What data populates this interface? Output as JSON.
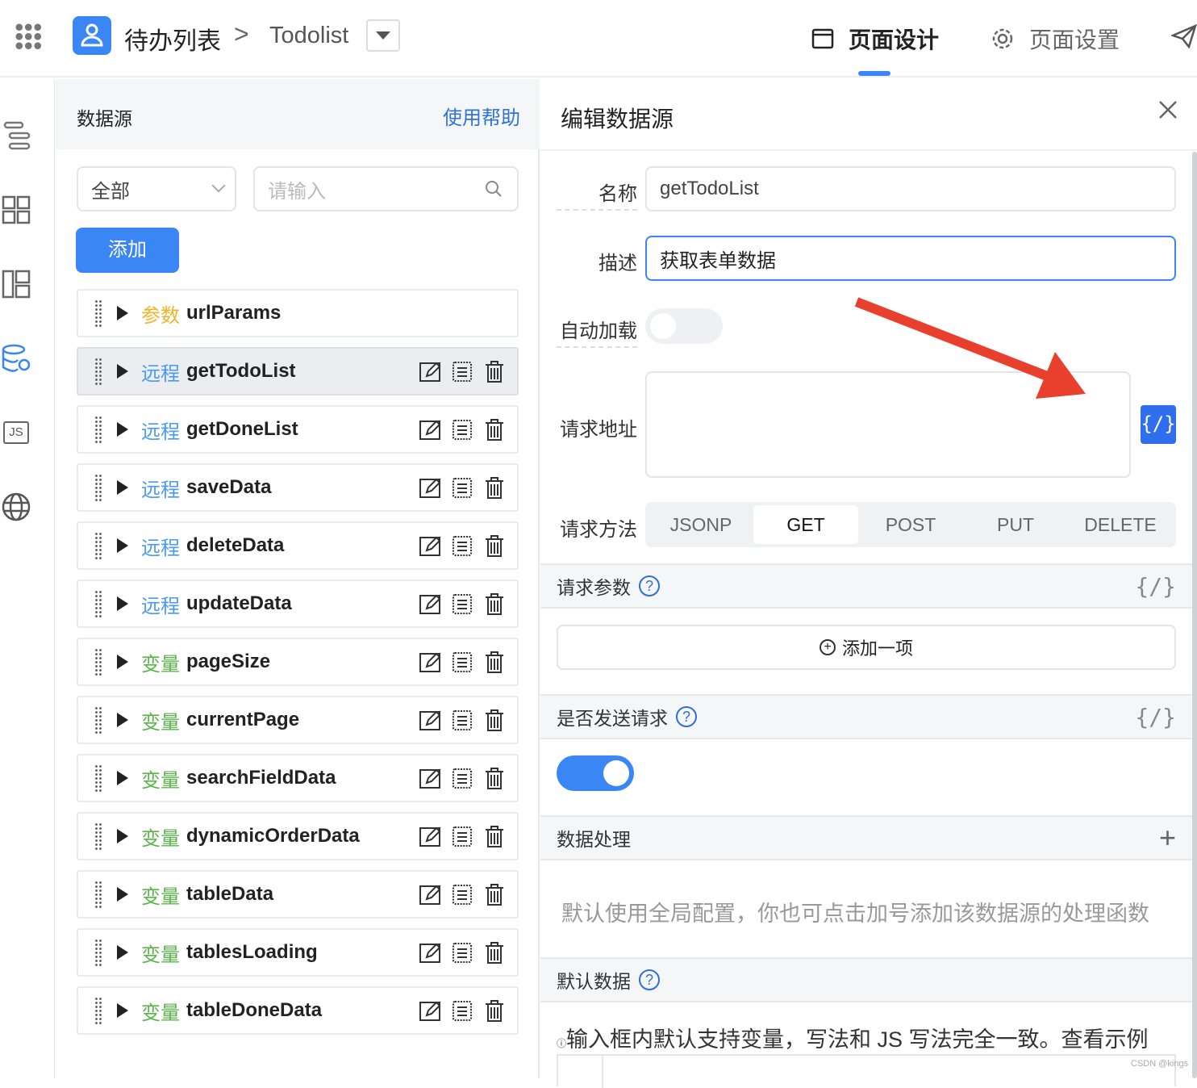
{
  "topbar": {
    "app_title": "待办列表",
    "page_name": "Todolist",
    "tabs": [
      {
        "label": "页面设计",
        "active": true
      },
      {
        "label": "页面设置",
        "active": false
      }
    ]
  },
  "colors": {
    "accent": "#3a86f5",
    "param_tag": "#f0b429",
    "remote_tag": "#4a9af5",
    "var_tag": "#5bb54a"
  },
  "left_panel": {
    "title": "数据源",
    "help": "使用帮助",
    "filter_value": "全部",
    "search_placeholder": "请输入",
    "add_label": "添加",
    "items": [
      {
        "tag": "参数",
        "type": "param",
        "name": "urlParams",
        "actions": false
      },
      {
        "tag": "远程",
        "type": "remote",
        "name": "getTodoList",
        "actions": true,
        "selected": true
      },
      {
        "tag": "远程",
        "type": "remote",
        "name": "getDoneList",
        "actions": true
      },
      {
        "tag": "远程",
        "type": "remote",
        "name": "saveData",
        "actions": true
      },
      {
        "tag": "远程",
        "type": "remote",
        "name": "deleteData",
        "actions": true
      },
      {
        "tag": "远程",
        "type": "remote",
        "name": "updateData",
        "actions": true
      },
      {
        "tag": "变量",
        "type": "var",
        "name": "pageSize",
        "actions": true
      },
      {
        "tag": "变量",
        "type": "var",
        "name": "currentPage",
        "actions": true
      },
      {
        "tag": "变量",
        "type": "var",
        "name": "searchFieldData",
        "actions": true
      },
      {
        "tag": "变量",
        "type": "var",
        "name": "dynamicOrderData",
        "actions": true
      },
      {
        "tag": "变量",
        "type": "var",
        "name": "tableData",
        "actions": true
      },
      {
        "tag": "变量",
        "type": "var",
        "name": "tablesLoading",
        "actions": true
      },
      {
        "tag": "变量",
        "type": "var",
        "name": "tableDoneData",
        "actions": true
      }
    ]
  },
  "editor": {
    "title": "编辑数据源",
    "name_label": "名称",
    "name_value": "getTodoList",
    "desc_label": "描述",
    "desc_value": "获取表单数据",
    "autoload_label": "自动加载",
    "autoload_on": false,
    "url_label": "请求地址",
    "url_value": "",
    "method_label": "请求方法",
    "methods": [
      "JSONP",
      "GET",
      "POST",
      "PUT",
      "DELETE"
    ],
    "method_selected": "GET",
    "params_title": "请求参数",
    "add_item": "添加一项",
    "send_title": "是否发送请求",
    "send_on": true,
    "process_title": "数据处理",
    "process_hint": "默认使用全局配置，你也可点击加号添加该数据源的处理函数",
    "default_title": "默认数据",
    "default_hint": "输入框内默认支持变量，写法和 JS 写法完全一致。查看示例",
    "code_symbol": "{/}"
  },
  "watermark": "CSDN @kings"
}
